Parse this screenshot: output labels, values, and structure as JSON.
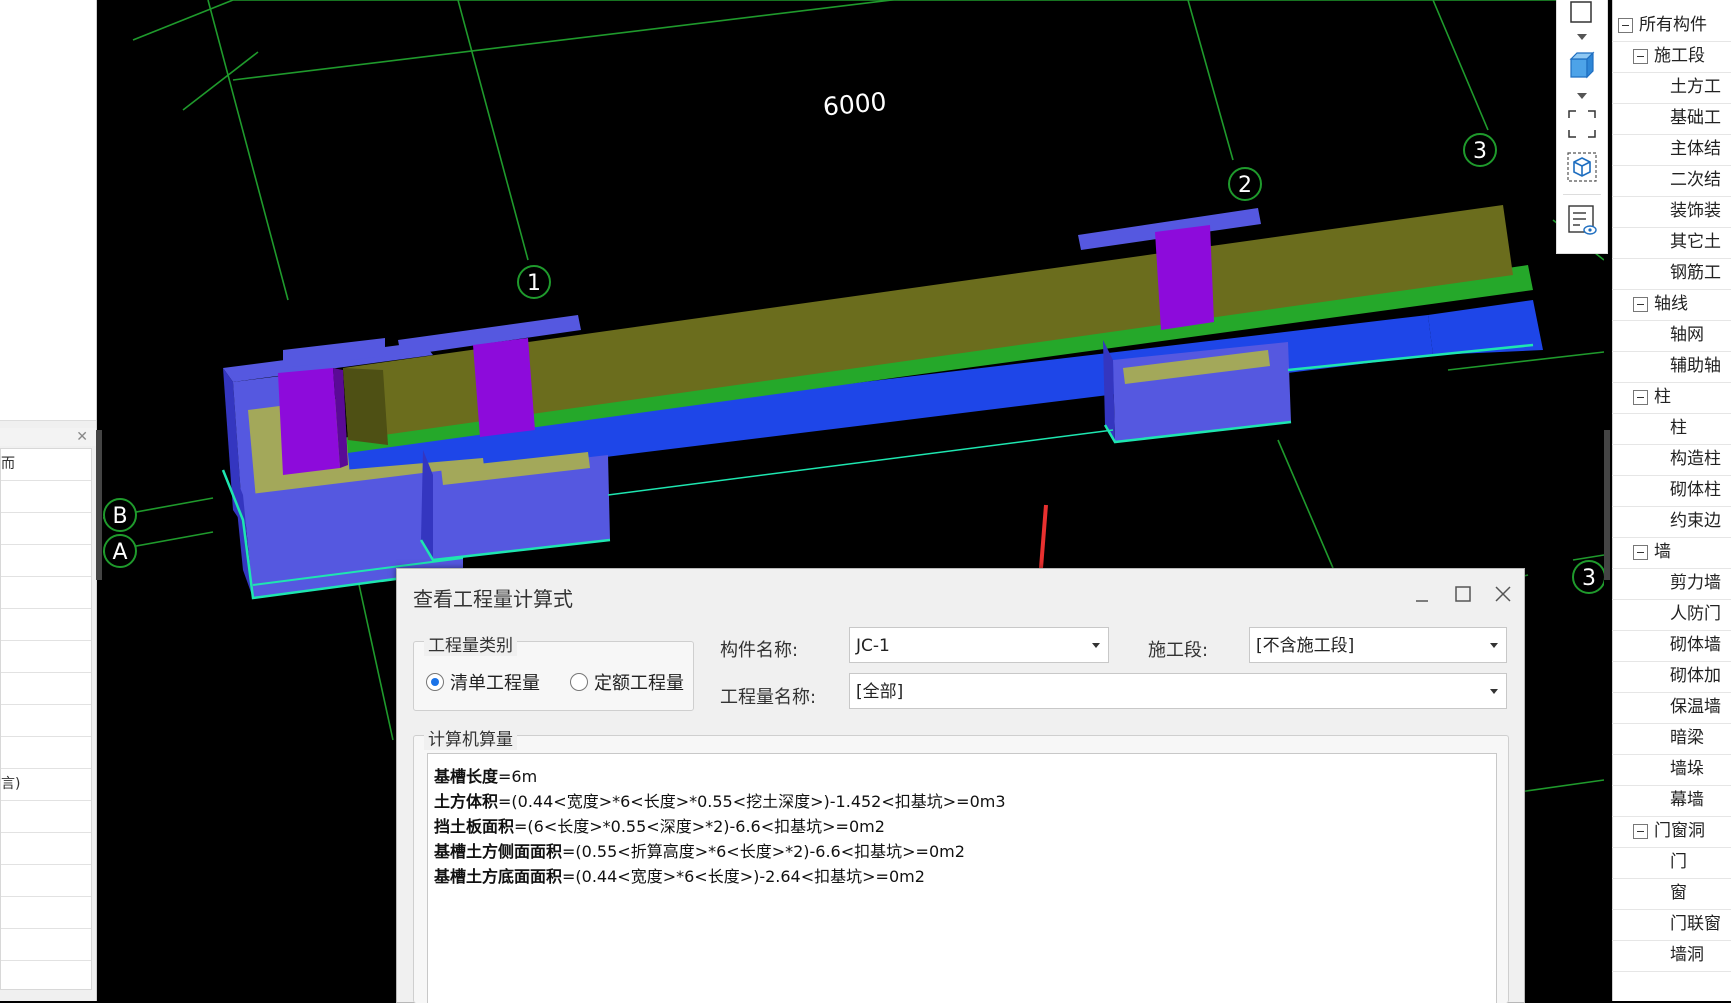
{
  "left_panel": {
    "rows": [
      "而",
      "",
      "",
      "",
      "",
      "",
      "",
      "",
      "",
      "",
      "言)",
      "",
      "",
      "",
      "",
      ""
    ]
  },
  "viewport": {
    "dimension_label": "6000",
    "axis_labels": {
      "num1": "1",
      "num2": "2",
      "num3": "3",
      "num3b": "3",
      "letB": "B",
      "letA": "A"
    }
  },
  "tree": {
    "items": [
      {
        "label": "所有构件",
        "level": 0,
        "expandable": true
      },
      {
        "label": "施工段",
        "level": 1,
        "expandable": true
      },
      {
        "label": "土方工",
        "level": 2
      },
      {
        "label": "基础工",
        "level": 2
      },
      {
        "label": "主体结",
        "level": 2
      },
      {
        "label": "二次结",
        "level": 2
      },
      {
        "label": "装饰装",
        "level": 2
      },
      {
        "label": "其它土",
        "level": 2
      },
      {
        "label": "钢筋工",
        "level": 2
      },
      {
        "label": "轴线",
        "level": 1,
        "expandable": true
      },
      {
        "label": "轴网",
        "level": 2
      },
      {
        "label": "辅助轴",
        "level": 2
      },
      {
        "label": "柱",
        "level": 1,
        "expandable": true
      },
      {
        "label": "柱",
        "level": 2
      },
      {
        "label": "构造柱",
        "level": 2
      },
      {
        "label": "砌体柱",
        "level": 2
      },
      {
        "label": "约束边",
        "level": 2
      },
      {
        "label": "墙",
        "level": 1,
        "expandable": true
      },
      {
        "label": "剪力墙",
        "level": 2
      },
      {
        "label": "人防门",
        "level": 2
      },
      {
        "label": "砌体墙",
        "level": 2
      },
      {
        "label": "砌体加",
        "level": 2
      },
      {
        "label": "保温墙",
        "level": 2
      },
      {
        "label": "暗梁",
        "level": 2
      },
      {
        "label": "墙垛",
        "level": 2
      },
      {
        "label": "幕墙",
        "level": 2
      },
      {
        "label": "门窗洞",
        "level": 1,
        "expandable": true
      },
      {
        "label": "门",
        "level": 2
      },
      {
        "label": "窗",
        "level": 2
      },
      {
        "label": "门联窗",
        "level": 2
      },
      {
        "label": "墙洞",
        "level": 2
      }
    ]
  },
  "dialog": {
    "title": "查看工程量计算式",
    "group_quantity_type": "工程量类别",
    "radio_bill": "清单工程量",
    "radio_quota": "定额工程量",
    "label_component": "构件名称:",
    "component_value": "JC-1",
    "label_section": "施工段:",
    "section_value": "[不含施工段]",
    "label_quantity_name": "工程量名称:",
    "quantity_name_value": "[全部]",
    "group_calc": "计算机算量",
    "lines": [
      {
        "name": "基槽长度",
        "expr": "=6m"
      },
      {
        "name": "土方体积",
        "expr": "=(0.44<宽度>*6<长度>*0.55<挖土深度>)-1.452<扣基坑>=0m3"
      },
      {
        "name": "挡土板面积",
        "expr": "=(6<长度>*0.55<深度>*2)-6.6<扣基坑>=0m2"
      },
      {
        "name": "基槽土方侧面面积",
        "expr": "=(0.55<折算高度>*6<长度>*2)-6.6<扣基坑>=0m2"
      },
      {
        "name": "基槽土方底面面积",
        "expr": "=(0.44<宽度>*6<长度>)-2.64<扣基坑>=0m2"
      }
    ]
  }
}
